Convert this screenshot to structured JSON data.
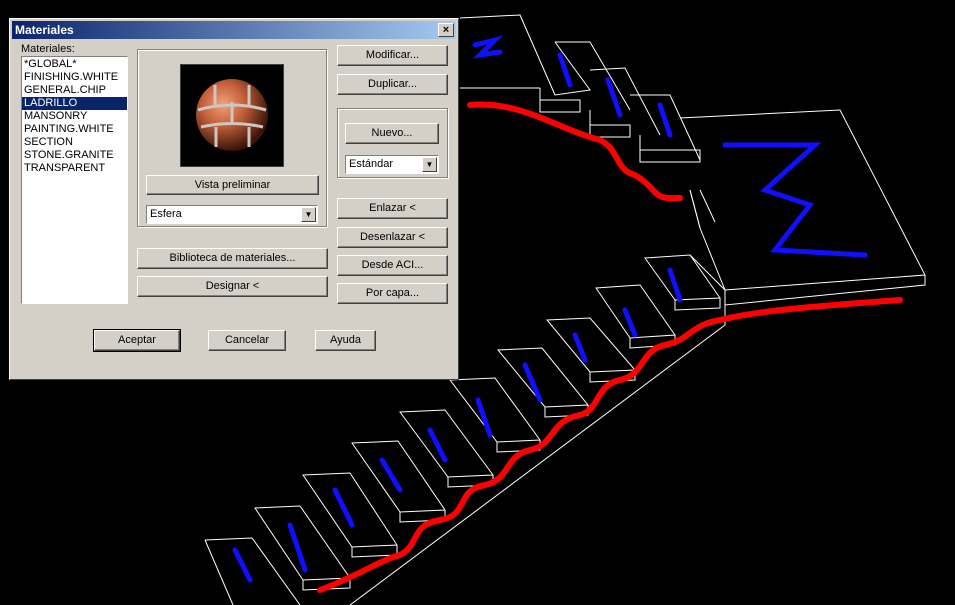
{
  "dialog": {
    "title": "Materiales",
    "close_glyph": "×",
    "materials_label": "Materiales:",
    "materials": [
      "*GLOBAL*",
      "FINISHING.WHITE",
      "GENERAL.CHIP",
      "LADRILLO",
      "MANSONRY",
      "PAINTING.WHITE",
      "SECTION",
      "STONE.GRANITE",
      "TRANSPARENT"
    ],
    "selected_material": "LADRILLO",
    "preview_button": "Vista preliminar",
    "preview_shape": "Esfera",
    "library_button": "Biblioteca de materiales...",
    "assign_button": "Designar <",
    "modify_button": "Modificar...",
    "duplicate_button": "Duplicar...",
    "new_button": "Nuevo...",
    "type_select": "Estándar",
    "attach_button": "Enlazar <",
    "detach_button": "Desenlazar <",
    "by_aci_button": "Desde ACI...",
    "by_layer_button": "Por capa...",
    "ok_button": "Aceptar",
    "cancel_button": "Cancelar",
    "help_button": "Ayuda"
  },
  "colors": {
    "title_start": "#0a246a",
    "title_end": "#a6caf0",
    "face": "#d4d0c8",
    "selection": "#0a246a",
    "brick": "#c4603a",
    "stair_line": "#ffffff",
    "material_red": "#ff0000",
    "material_blue": "#1010ff"
  },
  "icons": {
    "close": "close-icon",
    "dropdown": "chevron-down-icon",
    "preview": "brick-sphere-preview"
  }
}
